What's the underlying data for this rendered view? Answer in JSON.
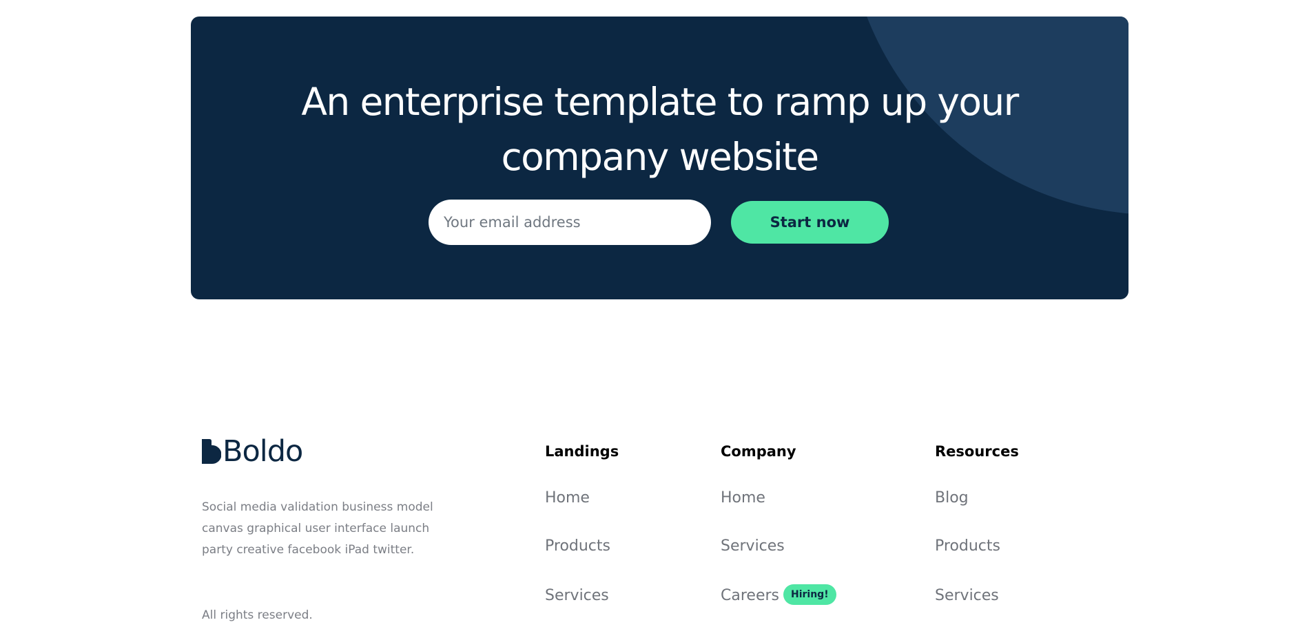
{
  "cta": {
    "title": "An enterprise template to ramp up your company website",
    "email_placeholder": "Your email address",
    "button_label": "Start now"
  },
  "footer": {
    "logo_text": "Boldo",
    "description": "Social media validation business model canvas graphical user interface launch party creative facebook iPad twitter.",
    "rights": "All rights reserved.",
    "columns": [
      {
        "heading": "Landings",
        "links": [
          "Home",
          "Products",
          "Services"
        ]
      },
      {
        "heading": "Company",
        "links": [
          "Home",
          "Services",
          "Careers"
        ],
        "badge": "Hiring!"
      },
      {
        "heading": "Resources",
        "links": [
          "Blog",
          "Products",
          "Services"
        ]
      }
    ]
  },
  "colors": {
    "navy": "#0c2742",
    "navy_light": "#1d3d5e",
    "accent_green": "#4fe6a4",
    "muted_text": "#6f737a"
  }
}
